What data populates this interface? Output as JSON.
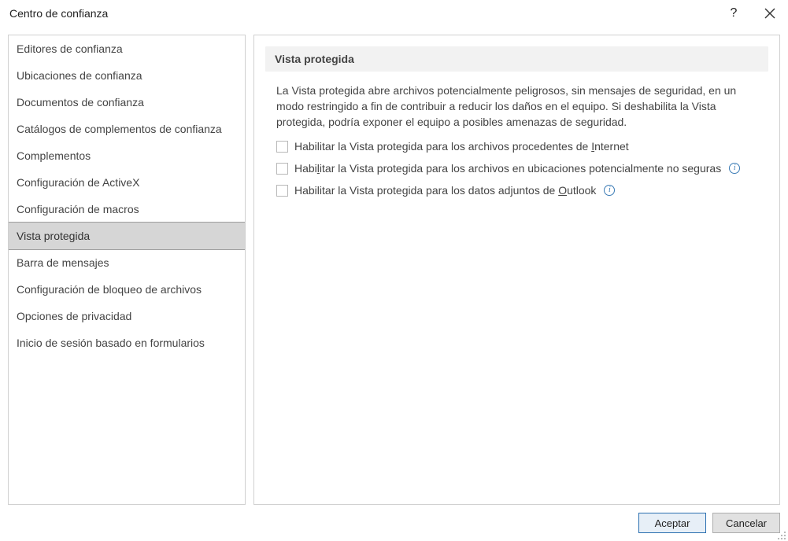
{
  "title": "Centro de confianza",
  "sidebar": {
    "items": [
      {
        "label": "Editores de confianza"
      },
      {
        "label": "Ubicaciones de confianza"
      },
      {
        "label": "Documentos de confianza"
      },
      {
        "label": "Catálogos de complementos de confianza"
      },
      {
        "label": "Complementos"
      },
      {
        "label": "Configuración de ActiveX"
      },
      {
        "label": "Configuración de macros"
      },
      {
        "label": "Vista protegida",
        "selected": true
      },
      {
        "label": "Barra de mensajes"
      },
      {
        "label": "Configuración de bloqueo de archivos"
      },
      {
        "label": "Opciones de privacidad"
      },
      {
        "label": "Inicio de sesión basado en formularios"
      }
    ]
  },
  "content": {
    "section_title": "Vista protegida",
    "description": "La Vista protegida abre archivos potencialmente peligrosos, sin mensajes de seguridad, en un modo restringido a fin de contribuir a reducir los daños en el equipo. Si deshabilita la Vista protegida, podría exponer el equipo a posibles amenazas de seguridad.",
    "checkboxes": [
      {
        "pre": "Habilitar la Vista protegida para los archivos procedentes de ",
        "u": "I",
        "post": "nternet",
        "checked": false,
        "info": false
      },
      {
        "pre": "Habi",
        "u": "l",
        "post": "itar la Vista protegida para los archivos en ubicaciones potencialmente no seguras",
        "checked": false,
        "info": true
      },
      {
        "pre": "Habilitar la Vista protegida para los datos adjuntos de ",
        "u": "O",
        "post": "utlook",
        "checked": false,
        "info": true
      }
    ]
  },
  "footer": {
    "ok_label": "Aceptar",
    "cancel_label": "Cancelar"
  }
}
